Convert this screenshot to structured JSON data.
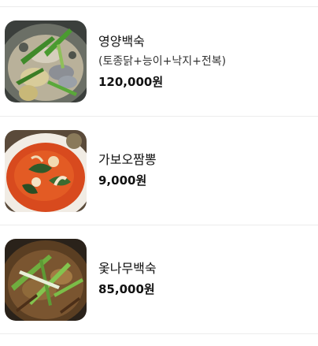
{
  "menu": {
    "items": [
      {
        "name": "영양백숙",
        "description": "(토종닭+능이+낙지+전복)",
        "price": "120,000원",
        "photo_icon": "soup-photo-icon"
      },
      {
        "name": "가보오짬뽕",
        "price": "9,000원",
        "photo_icon": "jjamppong-photo-icon"
      },
      {
        "name": "옻나무백숙",
        "price": "85,000원",
        "photo_icon": "soup-photo-icon"
      }
    ]
  },
  "colors": {
    "divider": "#ececec",
    "text": "#111111"
  }
}
